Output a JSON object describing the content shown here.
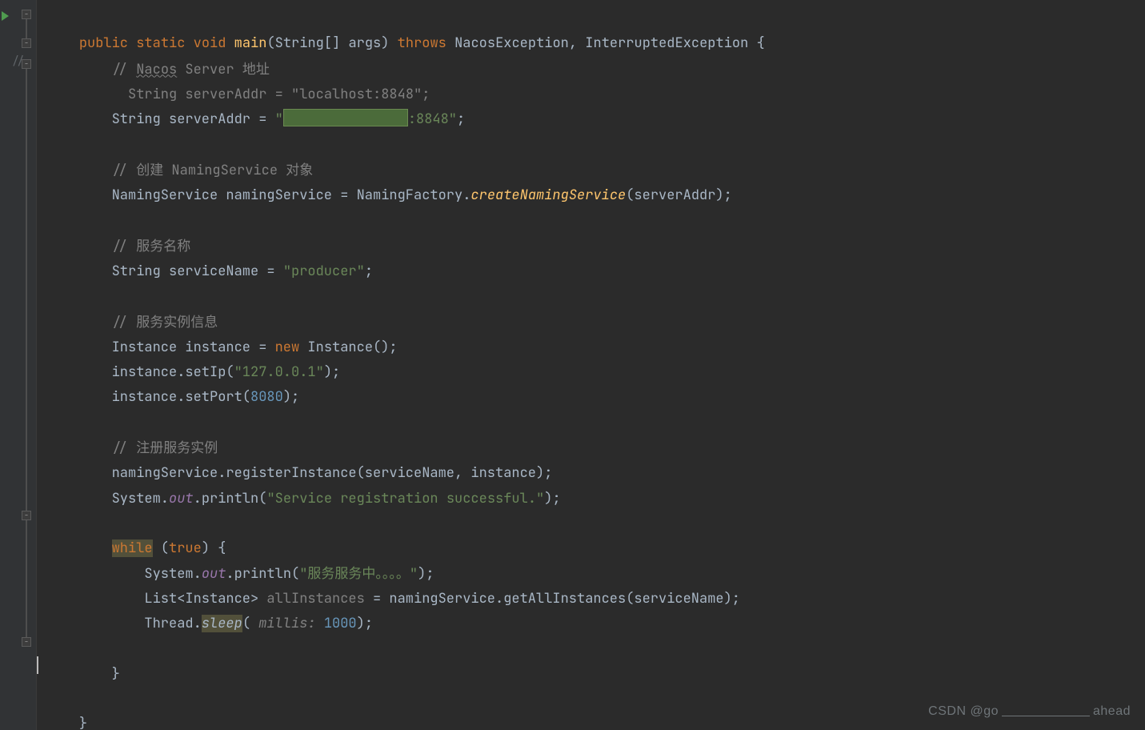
{
  "code": {
    "l1": {
      "kw_public": "public",
      "kw_static": "static",
      "kw_void": "void",
      "fn_main": "main",
      "paren_open": "(",
      "type_string_arr": "String[] args",
      "paren_close": ")",
      "kw_throws": "throws",
      "ex1": "NacosException",
      "comma": ", ",
      "ex2": "InterruptedException",
      "brace": " {"
    },
    "l2": {
      "prefix": "// ",
      "nacos": "Nacos",
      "server": " Server ",
      "cn": "地址"
    },
    "l3": {
      "pre": "  String serverAddr = ",
      "str": "\"localhost:8848\"",
      "semi": ";"
    },
    "l4": {
      "pre": "String serverAddr = ",
      "q1": "\"",
      "port": ":8848\"",
      "semi": ";"
    },
    "l5": {
      "prefix": "// ",
      "cn1": "创建",
      "mid": " NamingService ",
      "cn2": "对象"
    },
    "l6": {
      "a": "NamingService namingService = NamingFactory.",
      "fn": "createNamingService",
      "b": "(serverAddr);"
    },
    "l7": {
      "prefix": "// ",
      "cn": "服务名称"
    },
    "l8": {
      "a": "String serviceName = ",
      "str": "\"producer\"",
      "semi": ";"
    },
    "l9": {
      "prefix": "// ",
      "cn": "服务实例信息"
    },
    "l10": {
      "a": "Instance instance = ",
      "kw_new": "new",
      "b": " Instance();"
    },
    "l11": {
      "a": "instance.setIp(",
      "str": "\"127.0.0.1\"",
      "b": ");"
    },
    "l12": {
      "a": "instance.setPort(",
      "num": "8080",
      "b": ");"
    },
    "l13": {
      "prefix": "// ",
      "cn": "注册服务实例"
    },
    "l14": {
      "a": "namingService.registerInstance(serviceName, instance);"
    },
    "l15": {
      "a": "System.",
      "out": "out",
      "b": ".println(",
      "str": "\"Service registration successful.\"",
      "c": ");"
    },
    "l16": {
      "kw_while": "while",
      "a": " (",
      "kw_true": "true",
      "b": ") {"
    },
    "l17": {
      "a": "System.",
      "out": "out",
      "b": ".println(",
      "str": "\"服务服务中。。。。\"",
      "c": ");"
    },
    "l18": {
      "a": "List<Instance> ",
      "var": "allInstances",
      "b": " = namingService.getAllInstances(serviceName);"
    },
    "l19": {
      "a": "Thread.",
      "sleep": "sleep",
      "b": "( ",
      "hint": "millis:",
      "sp": " ",
      "num": "1000",
      "c": ");"
    },
    "l20": {
      "brace": "}"
    },
    "l21": {
      "brace": "}"
    }
  },
  "gutter_comment_marker": "//",
  "watermark": {
    "prefix": "CSDN @go",
    "suffix": "ahead"
  }
}
